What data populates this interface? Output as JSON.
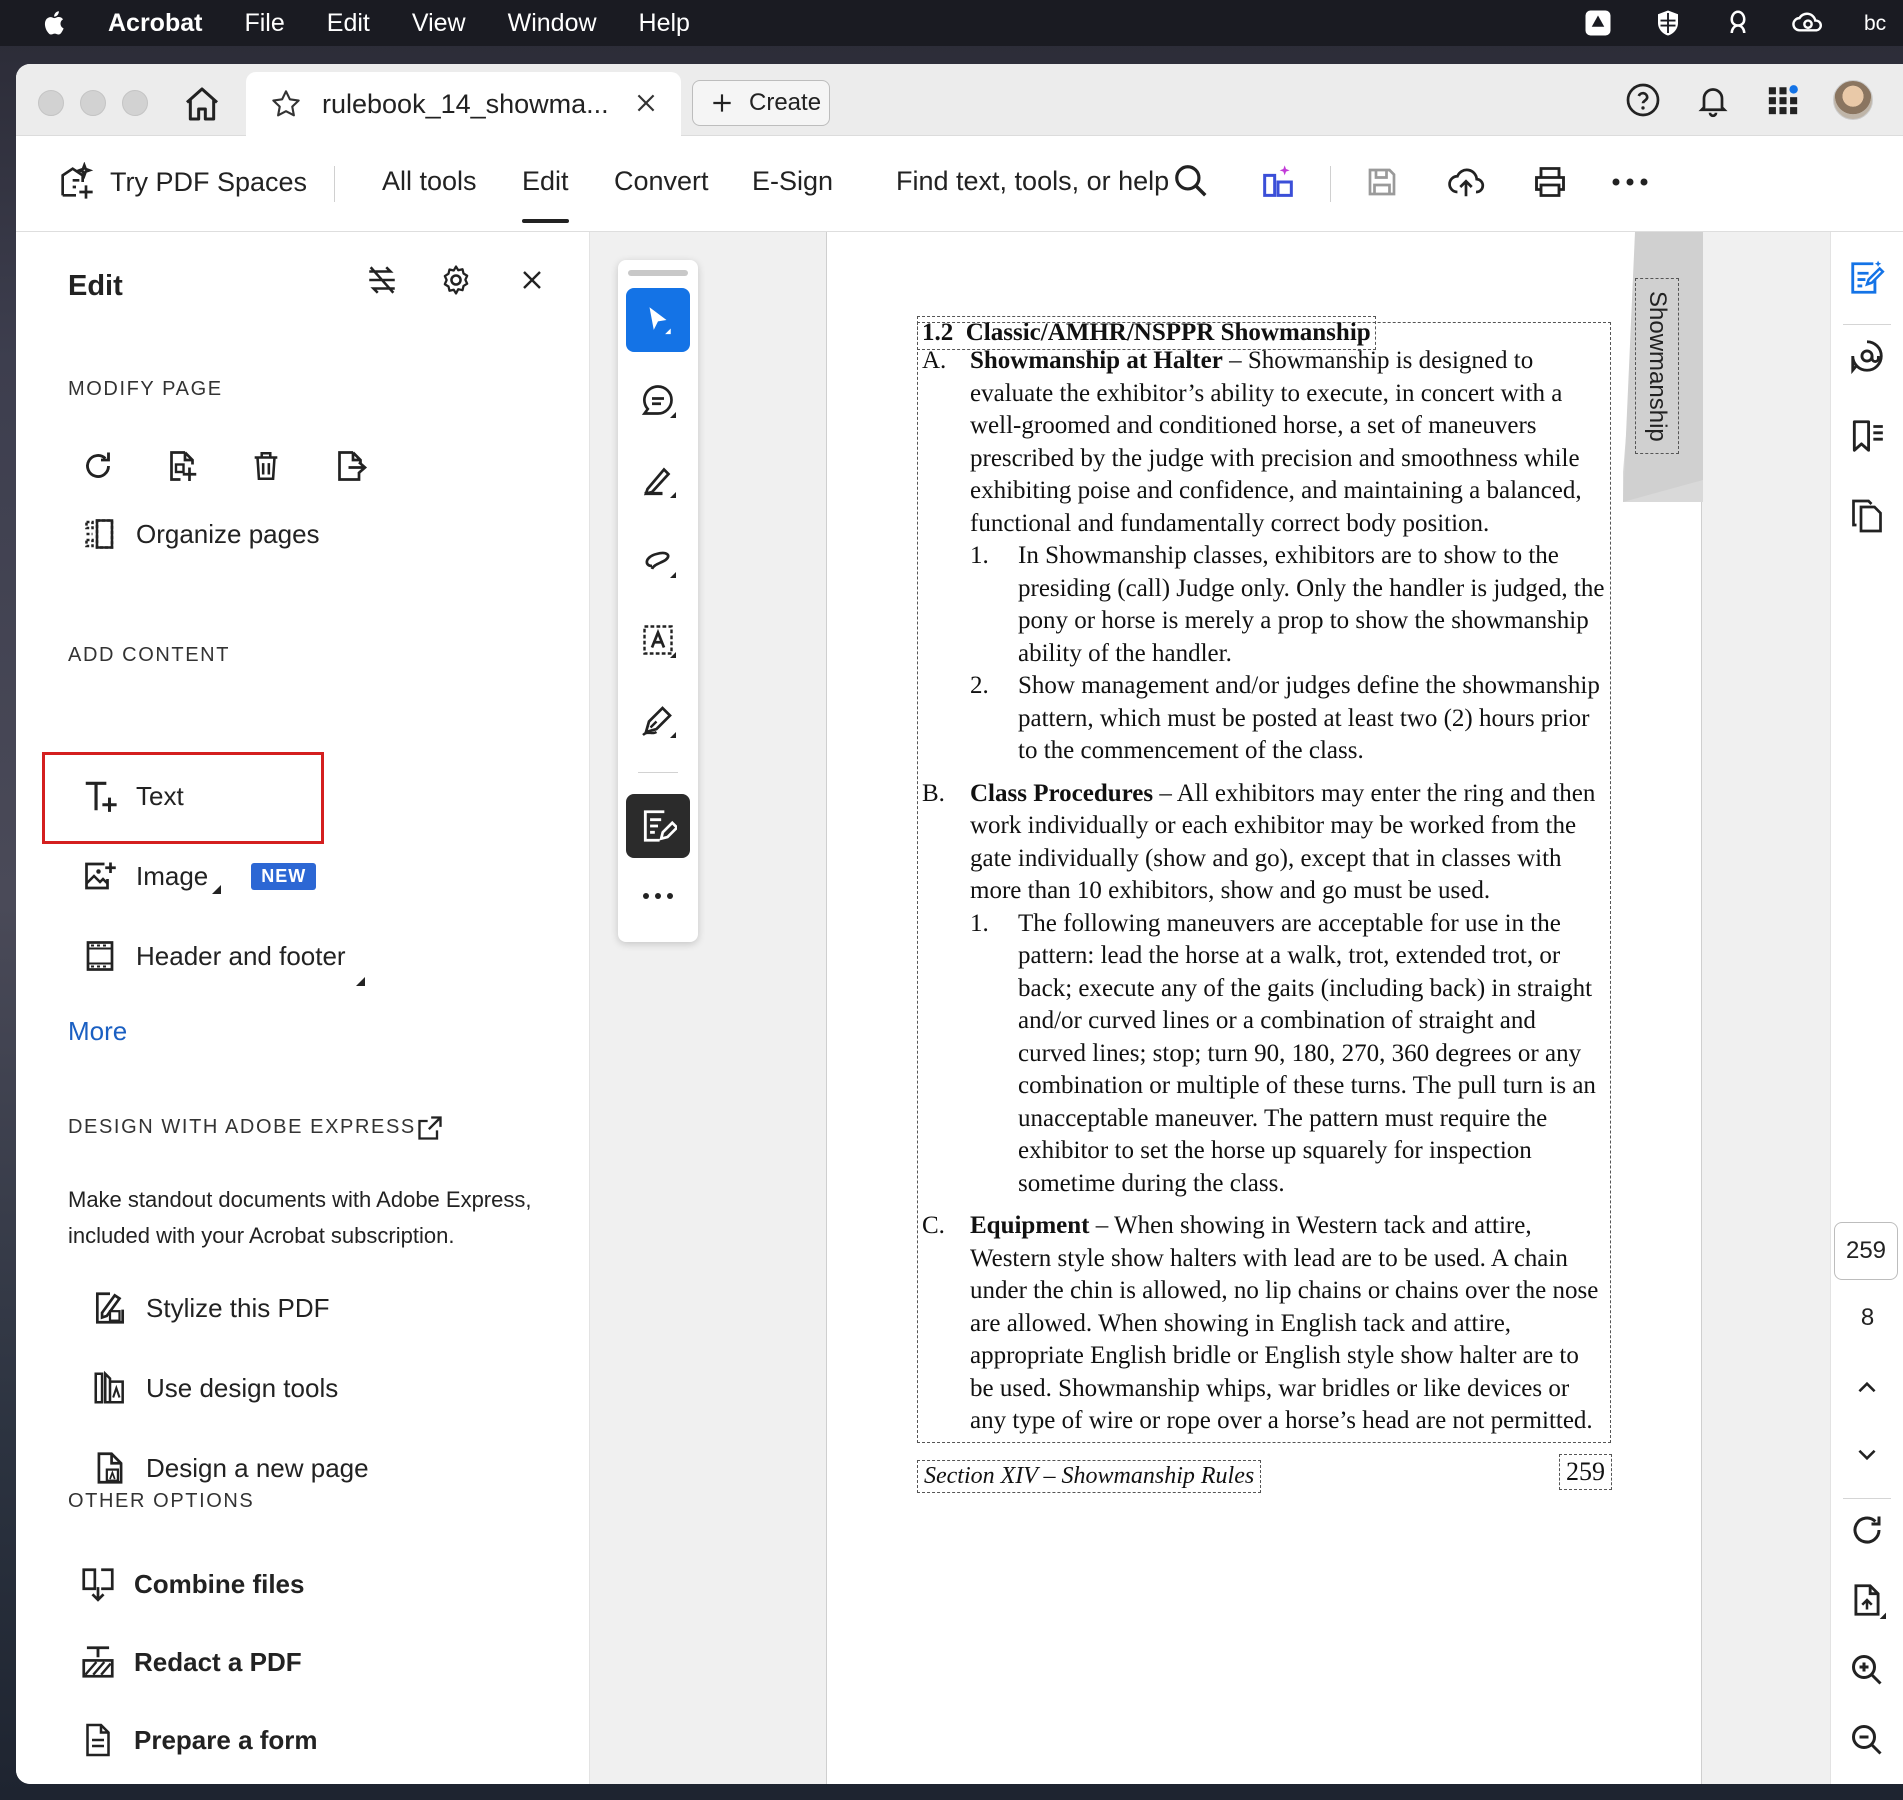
{
  "menubar": {
    "app": "Acrobat",
    "items": [
      "File",
      "Edit",
      "View",
      "Window",
      "Help"
    ]
  },
  "titlebar": {
    "tab_title": "rulebook_14_showma...",
    "create_label": "Create"
  },
  "toolbar": {
    "spaces_label": "Try PDF Spaces",
    "nav": [
      "All tools",
      "Edit",
      "Convert",
      "E-Sign"
    ],
    "active_nav": "Edit",
    "find_label": "Find text, tools, or help"
  },
  "leftpanel": {
    "title": "Edit",
    "modify_heading": "MODIFY PAGE",
    "organize_label": "Organize pages",
    "add_heading": "ADD CONTENT",
    "text_label": "Text",
    "image_label": "Image",
    "new_badge": "NEW",
    "header_footer_label": "Header and footer",
    "more_label": "More",
    "design_heading": "DESIGN WITH ADOBE EXPRESS",
    "design_desc": "Make standout documents with Adobe Express, included with your Acrobat subscription.",
    "stylize_label": "Stylize this PDF",
    "design_tools_label": "Use design tools",
    "new_page_label": "Design a new page",
    "other_heading": "OTHER OPTIONS",
    "combine_label": "Combine files",
    "redact_label": "Redact a PDF",
    "form_label": "Prepare a form"
  },
  "document": {
    "tab_marker": "Showmanship",
    "section_title": "1.2  Classic/AMHR/NSPPR Showmanship",
    "a_label": "A.",
    "a_head": "Showmanship at Halter",
    "a_text": " – Showmanship is designed to evaluate the exhibitor’s ability to execute, in concert with a well-groomed and conditioned horse, a set of maneuvers prescribed by the judge with precision and smoothness while exhibiting poise and confidence, and maintaining a balanced, functional and fundamentally correct body position.",
    "a1_label": "1.",
    "a1_text": "In Showmanship classes, exhibitors are to show to the presiding (call) Judge only. Only the handler is judged, the pony or horse is merely a prop to show the showmanship ability of the handler.",
    "a2_label": "2.",
    "a2_text": "Show management and/or judges define the show­manship pattern, which must be posted at least two (2) hours prior to the commencement of the class.",
    "b_label": "B.",
    "b_head": "Class Procedures",
    "b_text": " – All exhibitors may enter the ring and then work individually or each exhibitor may be worked from the gate individually (show and go), except that in classes with more than 10 exhibitors, show and go must be used.",
    "b1_label": "1.",
    "b1_text": "The following maneuvers are acceptable for use in the pattern: lead the horse at a walk, trot, extended trot, or back; execute any of the gaits (including back) in straight and/or curved lines or a combina­tion of straight and curved lines; stop; turn 90, 180, 270, 360 degrees or any combination or multiple of these turns. The pull turn is an unacceptable maneu­ver. The pattern must require the exhibitor to set the horse up squarely for inspection sometime during the class.",
    "c_label": "C.",
    "c_head": "Equipment",
    "c_text": " – When showing in Western tack and attire, Western style show halters with lead are to be used. A chain under the chin is allowed, no lip chains or chains over the nose are allowed. When showing in English tack and attire, appropriate English bridle or English style show halter are to be used. Showmanship whips, war bridles or like devices or any type of wire or rope over a horse’s head are not permitted.",
    "footer_section": "Section XIV – Showmanship Rules",
    "footer_page": "259"
  },
  "rightrail": {
    "current_page": "259",
    "total_pages": "8"
  },
  "colors": {
    "accent": "#1473e6",
    "highlight": "#d41f1f",
    "link": "#1a5fc2",
    "badge": "#2c67d4"
  }
}
